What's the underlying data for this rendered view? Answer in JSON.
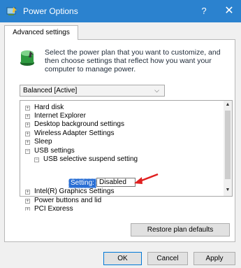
{
  "window": {
    "title": "Power Options",
    "help_label": "?",
    "close_label": "✕"
  },
  "tab": {
    "label": "Advanced settings"
  },
  "description": "Select the power plan that you want to customize, and then choose settings that reflect how you want your computer to manage power.",
  "plan_dropdown": {
    "selected": "Balanced [Active]",
    "chevron": "⌵"
  },
  "tree": {
    "items": [
      {
        "label": "Hard disk",
        "expander": "+"
      },
      {
        "label": "Internet Explorer",
        "expander": "+"
      },
      {
        "label": "Desktop background settings",
        "expander": "+"
      },
      {
        "label": "Wireless Adapter Settings",
        "expander": "+"
      },
      {
        "label": "Sleep",
        "expander": "+"
      },
      {
        "label": "USB settings",
        "expander": "−"
      },
      {
        "label": "USB selective suspend setting",
        "expander": "−"
      },
      {
        "label": "Intel(R) Graphics Settings",
        "expander": "+"
      },
      {
        "label": "Power buttons and lid",
        "expander": "+"
      },
      {
        "label": "PCI Express",
        "expander": "+"
      }
    ],
    "setting_label": "Setting:",
    "setting_value": "Disabled"
  },
  "scrollbar": {
    "up": "▲",
    "down": "▼"
  },
  "buttons": {
    "restore": "Restore plan defaults",
    "ok": "OK",
    "cancel": "Cancel",
    "apply": "Apply"
  },
  "colors": {
    "titlebar": "#2b82cf",
    "selection": "#2a6fd4",
    "annotation_arrow": "#e02020"
  }
}
